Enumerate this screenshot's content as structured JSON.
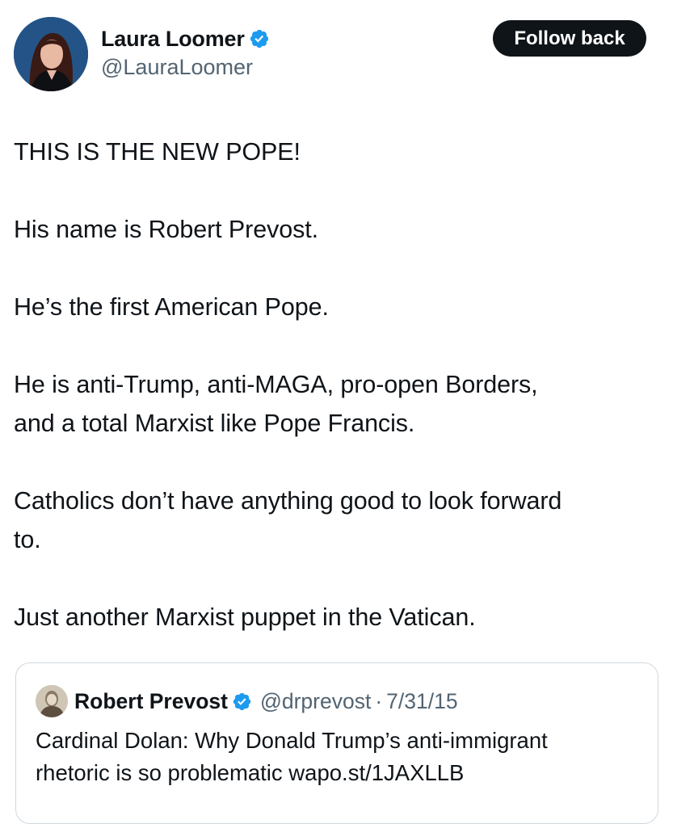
{
  "author": {
    "display_name": "Laura Loomer",
    "handle": "@LauraLoomer",
    "verified": true,
    "avatar_icon": "user-avatar-photo"
  },
  "actions": {
    "follow_label": "Follow back"
  },
  "tweet": {
    "paragraphs": [
      "THIS IS THE NEW POPE!",
      "His name is Robert Prevost.",
      "He’s the first American Pope.",
      "He is anti-Trump, anti-MAGA, pro-open Borders,\nand a total Marxist like Pope Francis.",
      "Catholics don’t have anything good to look forward\nto.",
      "Just another Marxist puppet in the Vatican."
    ]
  },
  "quote": {
    "display_name": "Robert Prevost",
    "handle": "@drprevost",
    "separator": "·",
    "date": "7/31/15",
    "verified": true,
    "text": "Cardinal Dolan: Why Donald Trump’s anti-immigrant\nrhetoric is so problematic wapo.st/1JAXLLB"
  },
  "colors": {
    "text_primary": "#0f1419",
    "text_secondary": "#536471",
    "verified_blue": "#1d9bf0",
    "button_bg": "#0f1419",
    "card_border": "#cfd9de"
  }
}
